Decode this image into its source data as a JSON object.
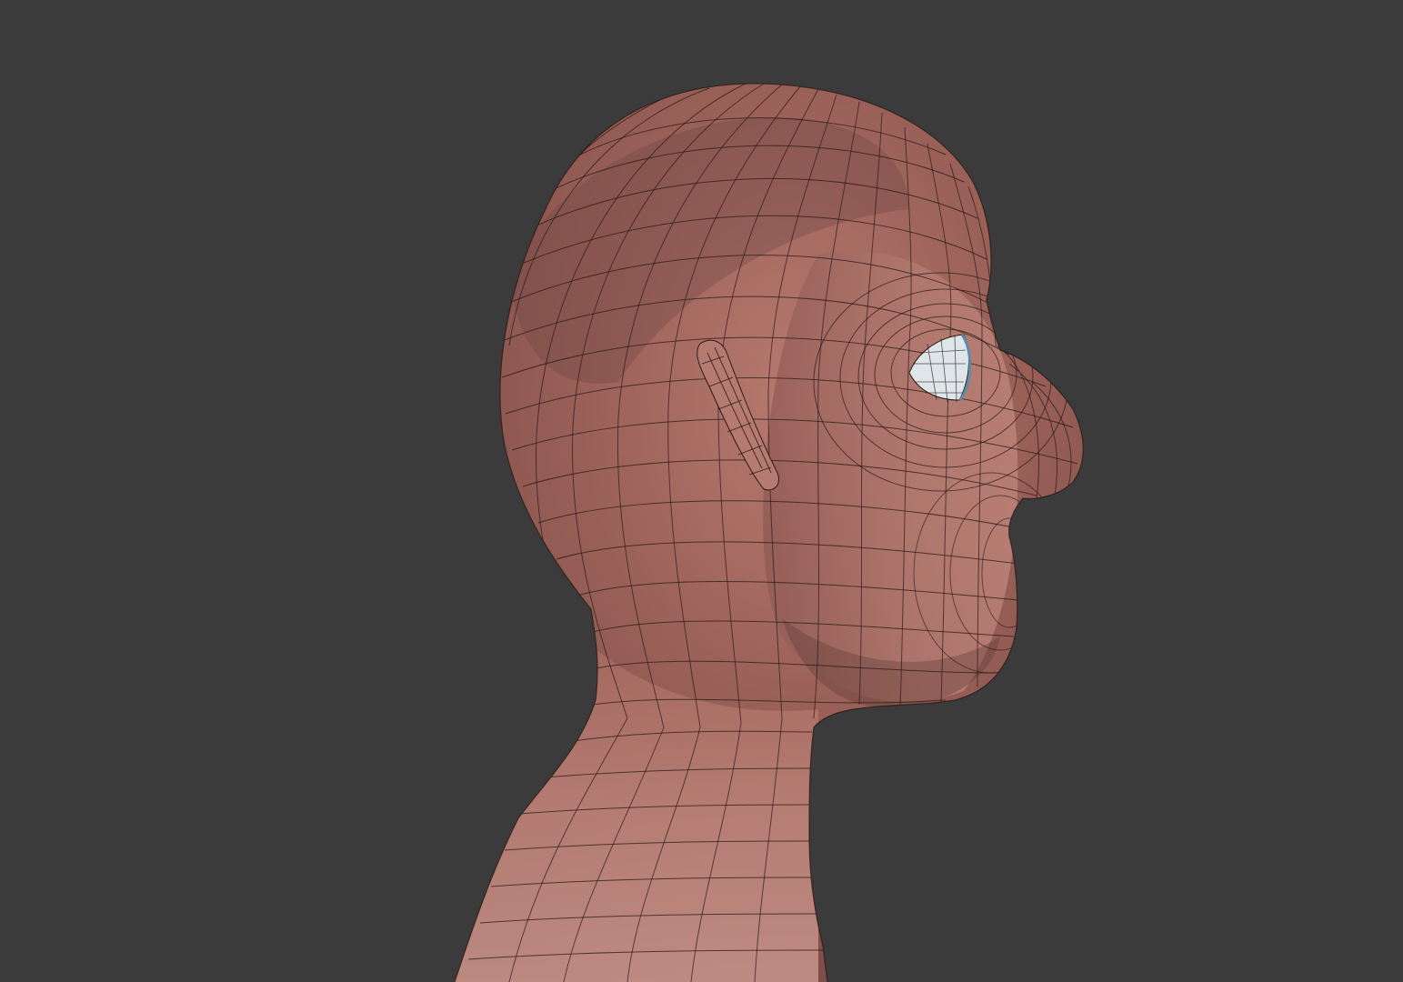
{
  "viewport": {
    "background_color": "#3b3b3b",
    "model": "head-bust-wireframe",
    "shading": "textured-with-wireframe-overlay"
  },
  "model_colors": {
    "skin_light": "#c48a80",
    "skin_mid": "#a8675e",
    "skin_dark": "#7a4a45",
    "wire": "#2a1a18",
    "eye": "#dfe6ea",
    "eye_shadow": "#6a8aa0"
  }
}
